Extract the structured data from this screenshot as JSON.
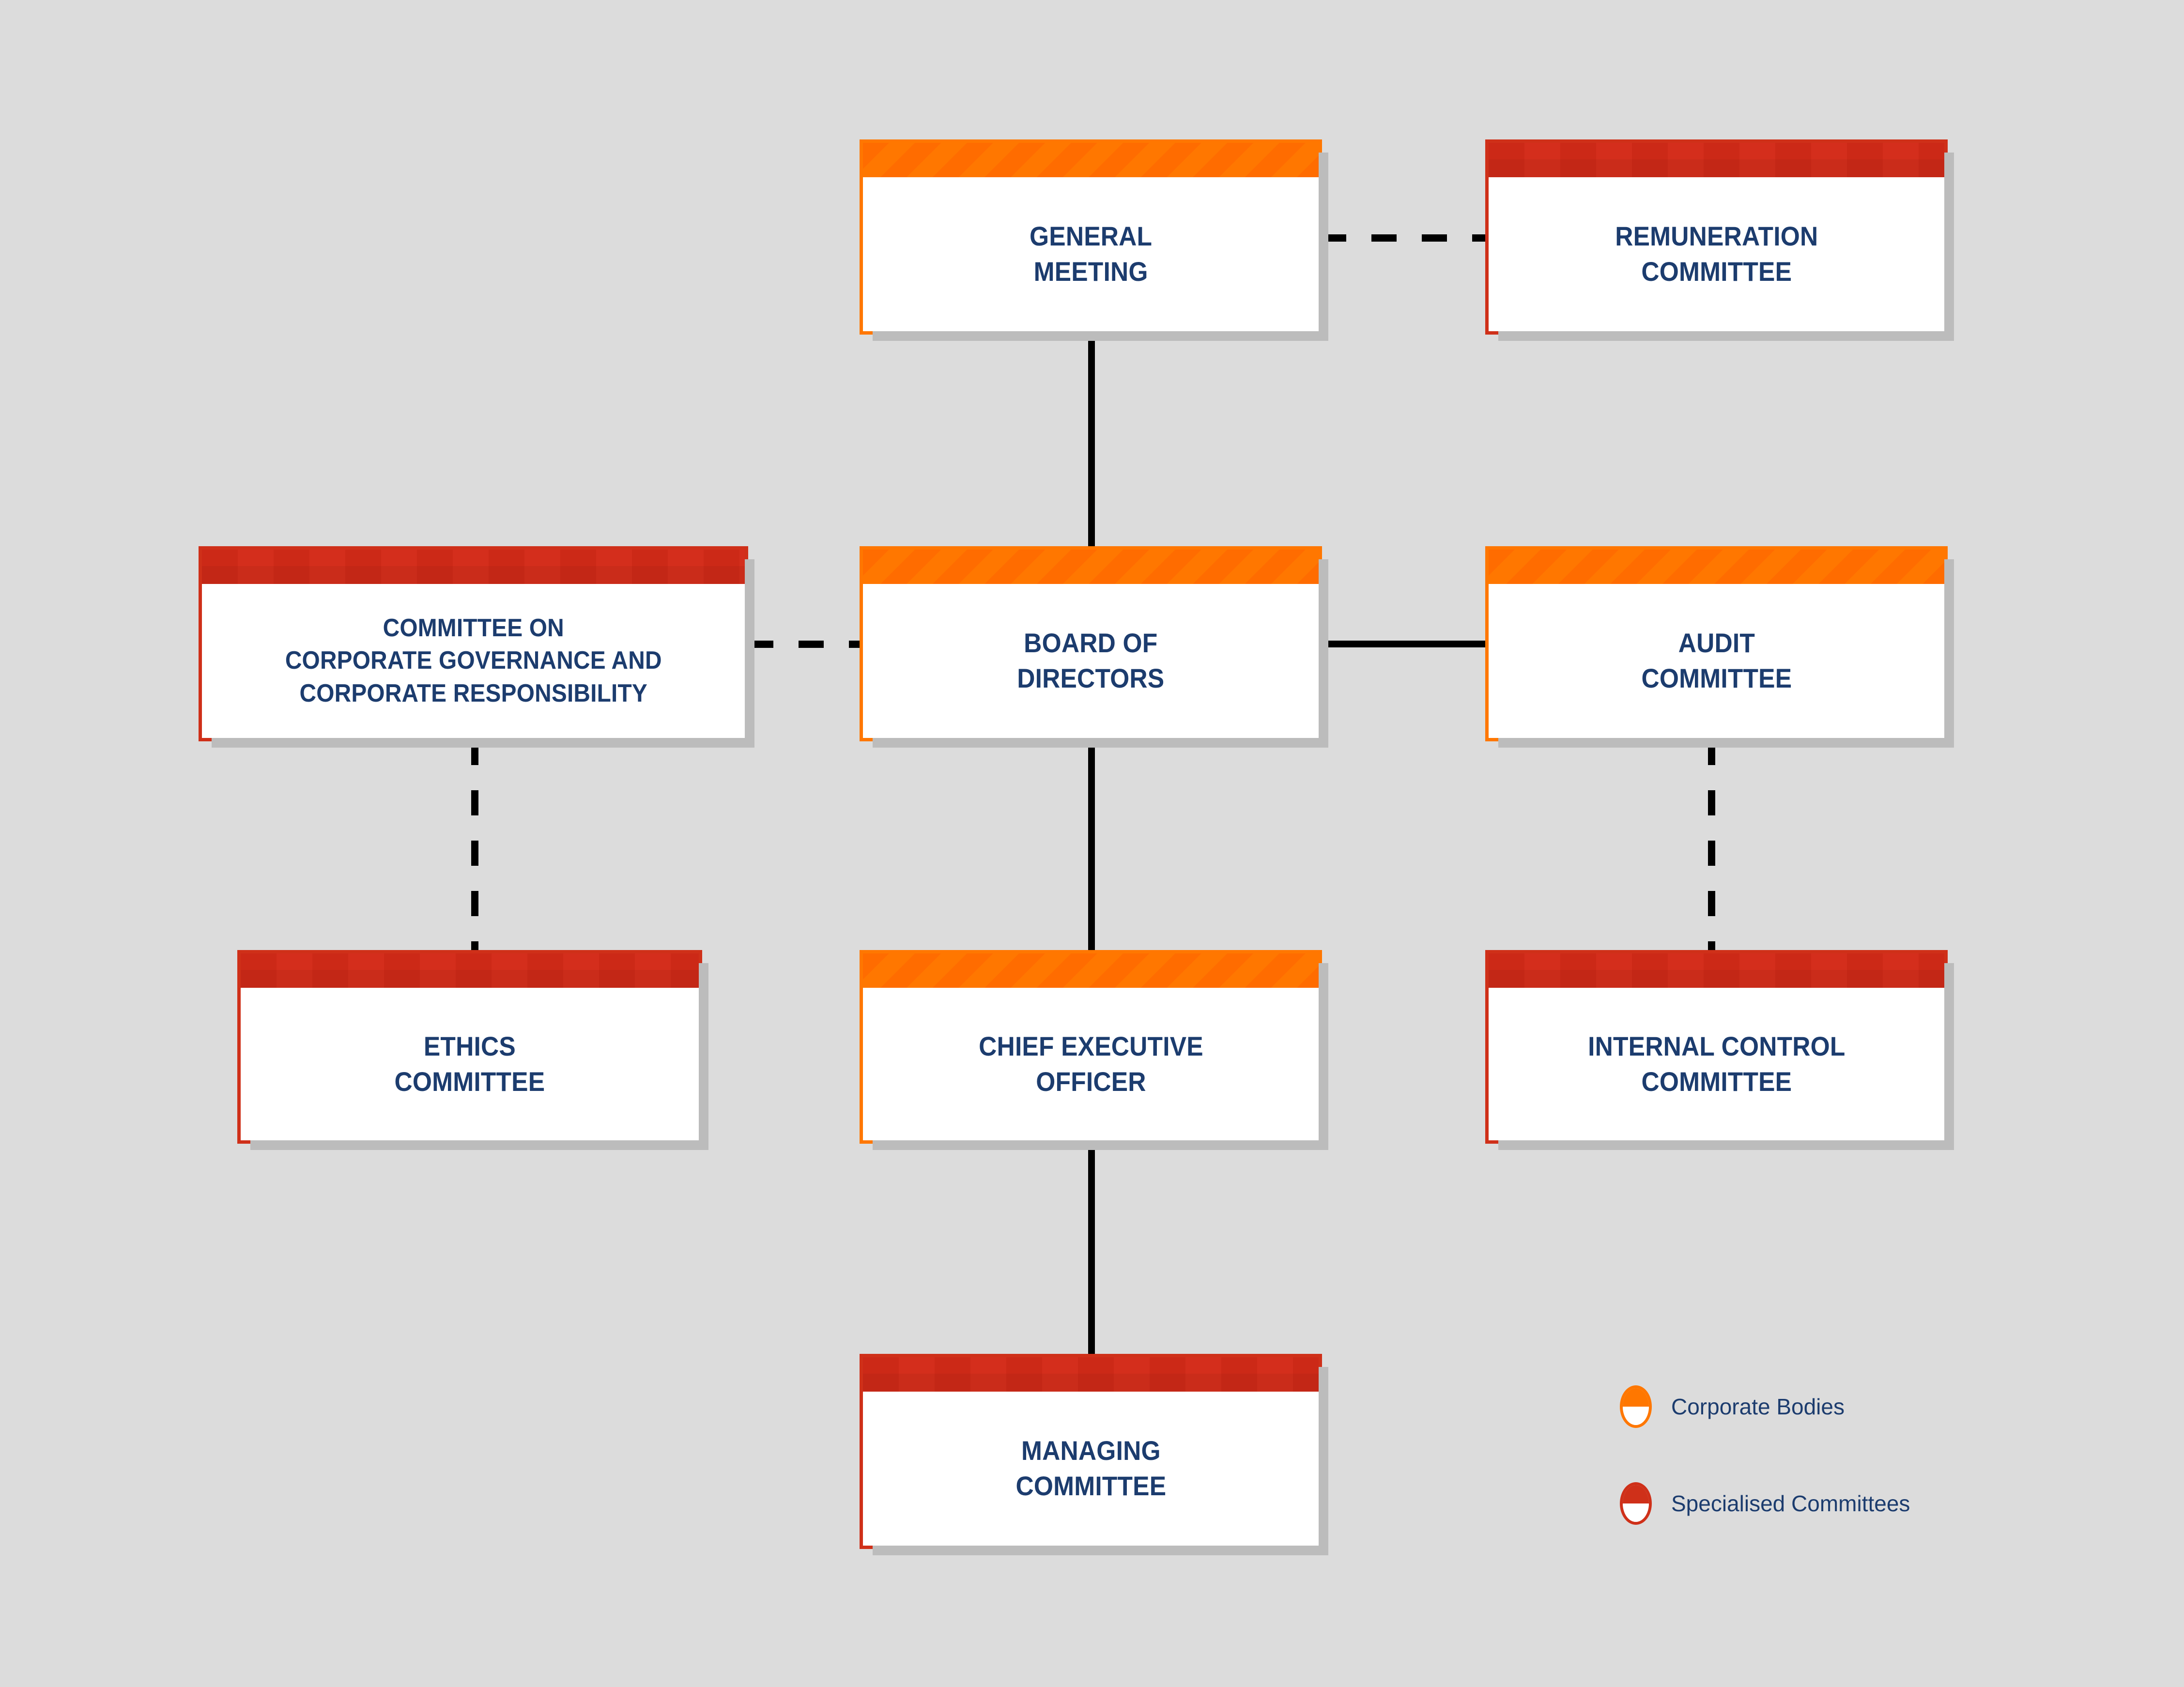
{
  "diagram": {
    "background_color": "#DCDCDC",
    "text_color": "#1C3C6E",
    "nodes": [
      {
        "id": "general-meeting",
        "label": "GENERAL\nMEETING",
        "category": "Corporate Bodies",
        "accent_color": "#FF7700"
      },
      {
        "id": "remuneration-committee",
        "label": "REMUNERATION\nCOMMITTEE",
        "category": "Specialised Committees",
        "accent_color": "#CF3019"
      },
      {
        "id": "committee-corporate-governance",
        "label": "COMMITTEE ON\nCORPORATE GOVERNANCE AND\nCORPORATE RESPONSIBILITY",
        "category": "Specialised Committees",
        "accent_color": "#CF3019"
      },
      {
        "id": "board-of-directors",
        "label": "BOARD OF\nDIRECTORS",
        "category": "Corporate Bodies",
        "accent_color": "#FF7700"
      },
      {
        "id": "audit-committee",
        "label": "AUDIT\nCOMMITTEE",
        "category": "Corporate Bodies",
        "accent_color": "#FF7700"
      },
      {
        "id": "ethics-committee",
        "label": "ETHICS\nCOMMITTEE",
        "category": "Specialised Committees",
        "accent_color": "#CF3019"
      },
      {
        "id": "chief-executive-officer",
        "label": "CHIEF EXECUTIVE\nOFFICER",
        "category": "Corporate Bodies",
        "accent_color": "#FF7700"
      },
      {
        "id": "internal-control-committee",
        "label": "INTERNAL CONTROL\nCOMMITTEE",
        "category": "Specialised Committees",
        "accent_color": "#CF3019"
      },
      {
        "id": "managing-committee",
        "label": "MANAGING\nCOMMITTEE",
        "category": "Specialised Committees",
        "accent_color": "#CF3019"
      }
    ],
    "connectors": [
      {
        "from": "general-meeting",
        "to": "remuneration-committee",
        "style": "dashed",
        "orientation": "horizontal"
      },
      {
        "from": "general-meeting",
        "to": "board-of-directors",
        "style": "solid",
        "orientation": "vertical"
      },
      {
        "from": "committee-corporate-governance",
        "to": "board-of-directors",
        "style": "dashed",
        "orientation": "horizontal"
      },
      {
        "from": "board-of-directors",
        "to": "audit-committee",
        "style": "solid",
        "orientation": "horizontal"
      },
      {
        "from": "committee-corporate-governance",
        "to": "ethics-committee",
        "style": "dashed",
        "orientation": "vertical"
      },
      {
        "from": "audit-committee",
        "to": "internal-control-committee",
        "style": "dashed",
        "orientation": "vertical"
      },
      {
        "from": "board-of-directors",
        "to": "chief-executive-officer",
        "style": "solid",
        "orientation": "vertical"
      },
      {
        "from": "chief-executive-officer",
        "to": "managing-committee",
        "style": "solid",
        "orientation": "vertical"
      }
    ]
  },
  "legend": {
    "items": [
      {
        "marker": "corporate-bodies-marker",
        "label": "Corporate Bodies",
        "color": "#FF7700"
      },
      {
        "marker": "specialised-committees-marker",
        "label": "Specialised Committees",
        "color": "#CF3019"
      }
    ]
  }
}
